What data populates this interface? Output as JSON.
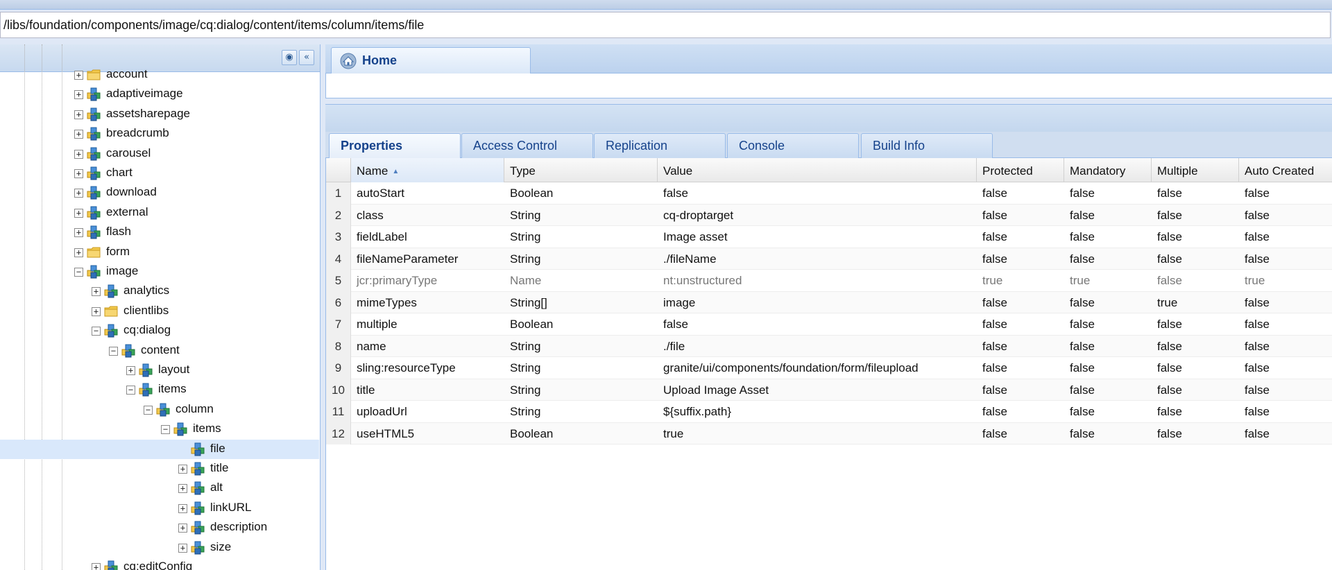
{
  "path_bar": {
    "value": "/libs/foundation/components/image/cq:dialog/content/items/column/items/file"
  },
  "left_panel": {
    "find_icon": "binoculars-icon",
    "collapse_icon": "double-chevron-left-icon"
  },
  "tree": {
    "nodes": [
      {
        "label": "account",
        "icon": "folder-icon",
        "toggle": "+",
        "level": 0
      },
      {
        "label": "adaptiveimage",
        "icon": "component-node-icon",
        "toggle": "+",
        "level": 0
      },
      {
        "label": "assetsharepage",
        "icon": "component-node-icon",
        "toggle": "+",
        "level": 0
      },
      {
        "label": "breadcrumb",
        "icon": "component-node-icon",
        "toggle": "+",
        "level": 0
      },
      {
        "label": "carousel",
        "icon": "component-node-icon",
        "toggle": "+",
        "level": 0
      },
      {
        "label": "chart",
        "icon": "component-node-icon",
        "toggle": "+",
        "level": 0
      },
      {
        "label": "download",
        "icon": "component-node-icon",
        "toggle": "+",
        "level": 0
      },
      {
        "label": "external",
        "icon": "component-node-icon",
        "toggle": "+",
        "level": 0
      },
      {
        "label": "flash",
        "icon": "component-node-icon",
        "toggle": "+",
        "level": 0
      },
      {
        "label": "form",
        "icon": "folder-icon",
        "toggle": "+",
        "level": 0
      },
      {
        "label": "image",
        "icon": "component-node-icon",
        "toggle": "-",
        "level": 0
      },
      {
        "label": "analytics",
        "icon": "component-node-icon",
        "toggle": "+",
        "level": 1
      },
      {
        "label": "clientlibs",
        "icon": "folder-icon",
        "toggle": "+",
        "level": 1
      },
      {
        "label": "cq:dialog",
        "icon": "component-node-icon",
        "toggle": "-",
        "level": 1
      },
      {
        "label": "content",
        "icon": "component-node-icon",
        "toggle": "-",
        "level": 2
      },
      {
        "label": "layout",
        "icon": "component-node-icon",
        "toggle": "+",
        "level": 3
      },
      {
        "label": "items",
        "icon": "component-node-icon",
        "toggle": "-",
        "level": 3
      },
      {
        "label": "column",
        "icon": "component-node-icon",
        "toggle": "-",
        "level": 4
      },
      {
        "label": "items",
        "icon": "component-node-icon",
        "toggle": "-",
        "level": 5
      },
      {
        "label": "file",
        "icon": "component-node-icon",
        "toggle": "",
        "level": 6,
        "selected": true
      },
      {
        "label": "title",
        "icon": "component-node-icon",
        "toggle": "+",
        "level": 6
      },
      {
        "label": "alt",
        "icon": "component-node-icon",
        "toggle": "+",
        "level": 6
      },
      {
        "label": "linkURL",
        "icon": "component-node-icon",
        "toggle": "+",
        "level": 6
      },
      {
        "label": "description",
        "icon": "component-node-icon",
        "toggle": "+",
        "level": 6
      },
      {
        "label": "size",
        "icon": "component-node-icon",
        "toggle": "+",
        "level": 6
      },
      {
        "label": "cq:editConfig",
        "icon": "component-node-icon",
        "toggle": "+",
        "level": 1
      }
    ]
  },
  "home_tab": {
    "label": "Home",
    "icon": "home-icon"
  },
  "tabs": [
    "Properties",
    "Access Control",
    "Replication",
    "Console",
    "Build Info"
  ],
  "grid": {
    "columns": [
      "Name",
      "Type",
      "Value",
      "Protected",
      "Mandatory",
      "Multiple",
      "Auto Created"
    ],
    "sort_indicator": "▲",
    "rows": [
      {
        "n": "1",
        "name": "autoStart",
        "type": "Boolean",
        "value": "false",
        "protected": "false",
        "mandatory": "false",
        "multiple": "false",
        "auto": "false"
      },
      {
        "n": "2",
        "name": "class",
        "type": "String",
        "value": "cq-droptarget",
        "protected": "false",
        "mandatory": "false",
        "multiple": "false",
        "auto": "false"
      },
      {
        "n": "3",
        "name": "fieldLabel",
        "type": "String",
        "value": "Image asset",
        "protected": "false",
        "mandatory": "false",
        "multiple": "false",
        "auto": "false"
      },
      {
        "n": "4",
        "name": "fileNameParameter",
        "type": "String",
        "value": "./fileName",
        "protected": "false",
        "mandatory": "false",
        "multiple": "false",
        "auto": "false"
      },
      {
        "n": "5",
        "name": "jcr:primaryType",
        "type": "Name",
        "value": "nt:unstructured",
        "protected": "true",
        "mandatory": "true",
        "multiple": "false",
        "auto": "true",
        "dim": true
      },
      {
        "n": "6",
        "name": "mimeTypes",
        "type": "String[]",
        "value": "image",
        "protected": "false",
        "mandatory": "false",
        "multiple": "true",
        "auto": "false"
      },
      {
        "n": "7",
        "name": "multiple",
        "type": "Boolean",
        "value": "false",
        "protected": "false",
        "mandatory": "false",
        "multiple": "false",
        "auto": "false"
      },
      {
        "n": "8",
        "name": "name",
        "type": "String",
        "value": "./file",
        "protected": "false",
        "mandatory": "false",
        "multiple": "false",
        "auto": "false"
      },
      {
        "n": "9",
        "name": "sling:resourceType",
        "type": "String",
        "value": "granite/ui/components/foundation/form/fileupload",
        "protected": "false",
        "mandatory": "false",
        "multiple": "false",
        "auto": "false"
      },
      {
        "n": "10",
        "name": "title",
        "type": "String",
        "value": "Upload Image Asset",
        "protected": "false",
        "mandatory": "false",
        "multiple": "false",
        "auto": "false"
      },
      {
        "n": "11",
        "name": "uploadUrl",
        "type": "String",
        "value": "${suffix.path}",
        "protected": "false",
        "mandatory": "false",
        "multiple": "false",
        "auto": "false"
      },
      {
        "n": "12",
        "name": "useHTML5",
        "type": "Boolean",
        "value": "true",
        "protected": "false",
        "mandatory": "false",
        "multiple": "false",
        "auto": "false"
      }
    ]
  },
  "colors": {
    "accent": "#15428b",
    "panel_border": "#99bbe8",
    "selected_row": "#d9e8fb"
  }
}
